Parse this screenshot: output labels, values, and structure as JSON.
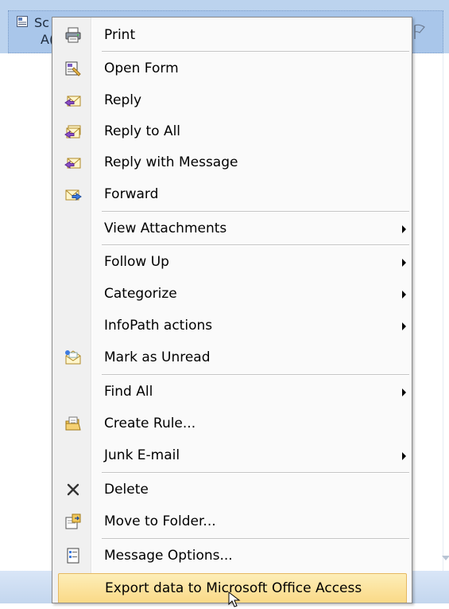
{
  "background": {
    "row_text_line1": "Sc",
    "row_text_line2": "A("
  },
  "menu": {
    "items": [
      {
        "label": "Print",
        "icon": "print-icon"
      },
      {
        "label": "Open Form",
        "icon": "open-form-icon"
      },
      {
        "label": "Reply",
        "icon": "reply-icon"
      },
      {
        "label": "Reply to All",
        "icon": "reply-all-icon"
      },
      {
        "label": "Reply with Message",
        "icon": "reply-with-message-icon"
      },
      {
        "label": "Forward",
        "icon": "forward-icon"
      },
      {
        "label": "View Attachments",
        "submenu": true
      },
      {
        "label": "Follow Up",
        "submenu": true
      },
      {
        "label": "Categorize",
        "submenu": true
      },
      {
        "label": "InfoPath actions",
        "submenu": true
      },
      {
        "label": "Mark as Unread",
        "icon": "mark-unread-icon"
      },
      {
        "label": "Find All",
        "submenu": true
      },
      {
        "label": "Create Rule...",
        "icon": "create-rule-icon"
      },
      {
        "label": "Junk E-mail",
        "submenu": true
      },
      {
        "label": "Delete",
        "icon": "delete-icon"
      },
      {
        "label": "Move to Folder...",
        "icon": "move-folder-icon"
      },
      {
        "label": "Message Options...",
        "icon": "message-options-icon"
      },
      {
        "label": "Export data to Microsoft Office Access",
        "highlighted": true
      }
    ]
  },
  "colors": {
    "highlight": "#fad987",
    "selection": "#a9c6ea"
  }
}
